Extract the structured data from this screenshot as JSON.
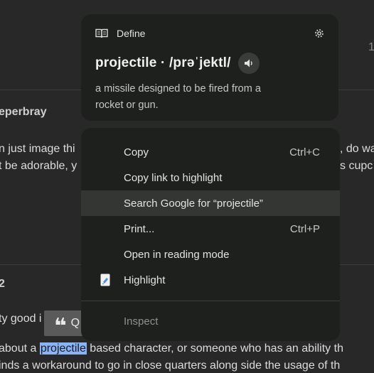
{
  "background": {
    "top_number": "1",
    "post1": {
      "username": "eperbray",
      "line1_left": "n just image thi",
      "line1_right": ", do wa",
      "line2_left": "t be adorable, y",
      "line2_right": "s cupc"
    },
    "post2": {
      "username": "2",
      "line1": "ty good i",
      "line2_before": "about a ",
      "line2_selected": "projectile",
      "line2_after": " based character, or someone who has an ability th",
      "line3": "inds a workaround to go in close quarters along side the usage of th"
    }
  },
  "quote_chip": {
    "mark": "❝",
    "label": "Q"
  },
  "define_card": {
    "header": "Define",
    "word_line": "projectile · /prəˈjektl/",
    "definition": "a missile designed to be fired from a rocket or gun."
  },
  "context_menu": {
    "items": [
      {
        "label": "Copy",
        "shortcut": "Ctrl+C"
      },
      {
        "label": "Copy link to highlight",
        "shortcut": ""
      },
      {
        "label": "Search Google for “projectile”",
        "shortcut": ""
      },
      {
        "label": "Print...",
        "shortcut": "Ctrl+P"
      },
      {
        "label": "Open in reading mode",
        "shortcut": ""
      },
      {
        "label": "Highlight",
        "shortcut": ""
      }
    ],
    "inspect": "Inspect"
  },
  "colors": {
    "selection": "#8ab4f8",
    "menu_bg": "#1e201e",
    "hover_bg": "#333633"
  }
}
